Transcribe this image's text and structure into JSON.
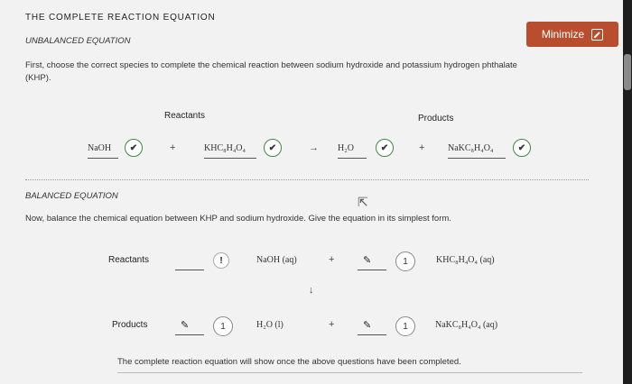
{
  "header": {
    "title": "THE COMPLETE REACTION EQUATION",
    "minimize_label": "Minimize"
  },
  "unbalanced": {
    "heading": "UNBALANCED EQUATION",
    "instruction_line1": "First, choose the correct species to complete the chemical reaction between sodium hydroxide and potassium hydrogen phthalate",
    "instruction_line2": "(KHP).",
    "reactants_label": "Reactants",
    "products_label": "Products",
    "species": [
      "NaOH",
      "KHC₈H₄O₄",
      "H₂O",
      "NaKC₈H₄O₄"
    ],
    "plus": "+",
    "arrow": "→"
  },
  "balanced": {
    "heading": "BALANCED EQUATION",
    "instruction": "Now, balance the chemical equation between KHP and sodium hydroxide. Give the equation in its simplest form.",
    "reactants_label": "Reactants",
    "products_label": "Products",
    "warning_symbol": "!",
    "reactant1": "NaOH (aq)",
    "reactant2": "KHC₈H₄O₄ (aq)",
    "product1": "H₂O (l)",
    "product2": "NaKC₈H₄O₄ (aq)",
    "coef_reactant2": "1",
    "coef_product1": "1",
    "coef_product2": "1",
    "plus": "+",
    "down_arrow": "↓"
  },
  "footer": {
    "note": "The complete reaction equation will show once the above questions have been completed."
  }
}
